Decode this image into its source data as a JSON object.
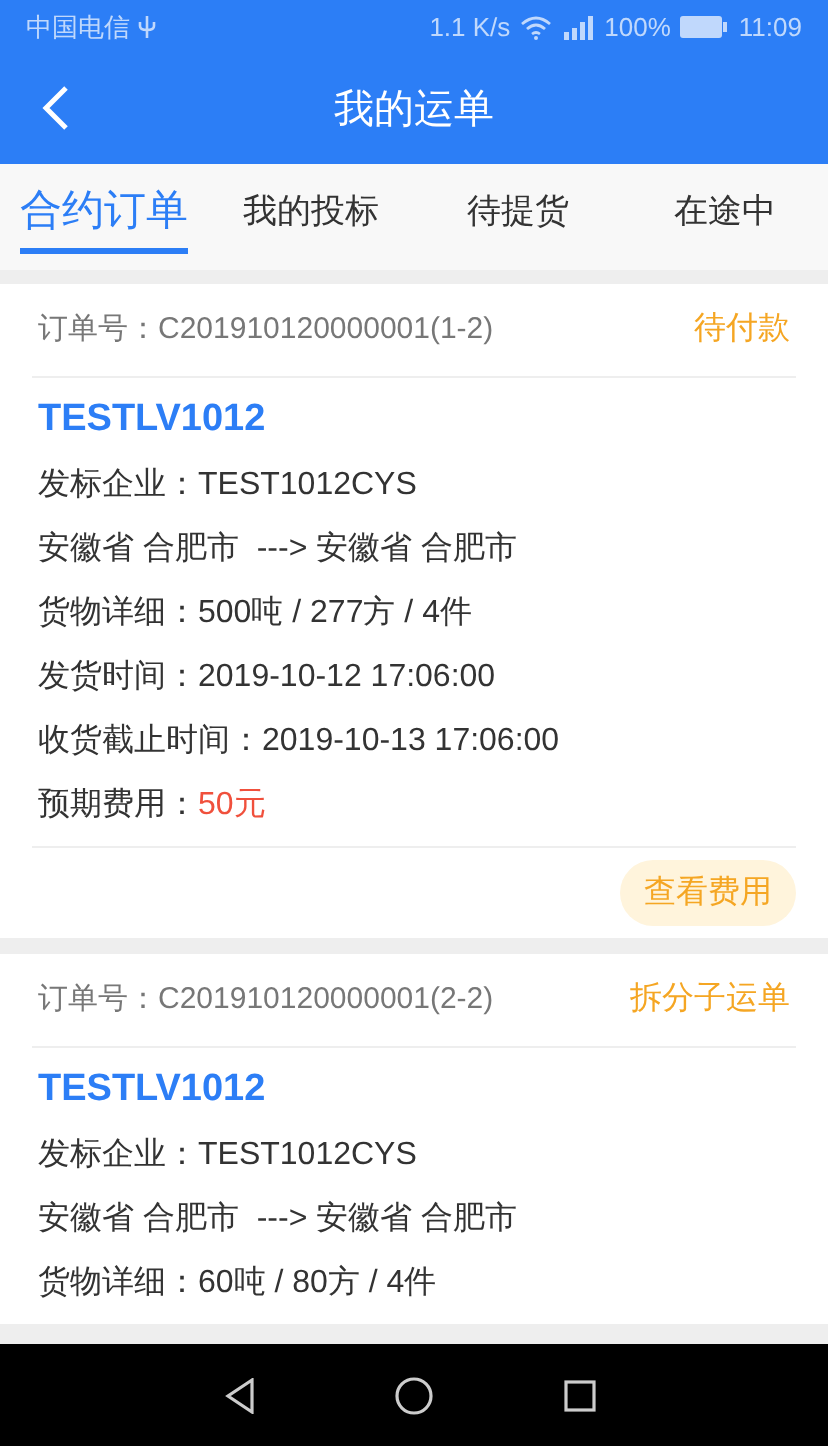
{
  "status_bar": {
    "carrier": "中国电信",
    "speed": "1.1 K/s",
    "battery": "100%",
    "time": "11:09"
  },
  "header": {
    "title": "我的运单"
  },
  "tabs": [
    {
      "label": "合约订单",
      "selected": true
    },
    {
      "label": "我的投标",
      "selected": false
    },
    {
      "label": "待提货",
      "selected": false
    },
    {
      "label": "在途中",
      "selected": false
    }
  ],
  "orders": [
    {
      "order_no": "订单号：C201910120000001(1-2)",
      "status": "待付款",
      "name": "TESTLV1012",
      "lines": [
        {
          "kind": "plain",
          "text": "发标企业：TEST1012CYS"
        },
        {
          "kind": "plain",
          "text": "安徽省 合肥市  ---> 安徽省 合肥市"
        },
        {
          "kind": "plain",
          "text": "货物详细：500吨 / 277方 / 4件"
        },
        {
          "kind": "plain",
          "text": "发货时间：2019-10-12 17:06:00"
        },
        {
          "kind": "plain",
          "text": "收货截止时间：2019-10-13 17:06:00"
        },
        {
          "kind": "cost",
          "label": "预期费用：",
          "value": "50元"
        }
      ],
      "button": "查看费用"
    },
    {
      "order_no": "订单号：C201910120000001(2-2)",
      "status": "拆分子运单",
      "name": "TESTLV1012",
      "lines": [
        {
          "kind": "plain",
          "text": "发标企业：TEST1012CYS"
        },
        {
          "kind": "plain",
          "text": "安徽省 合肥市  ---> 安徽省 合肥市"
        },
        {
          "kind": "plain",
          "text": "货物详细：60吨 / 80方 / 4件"
        }
      ]
    }
  ]
}
